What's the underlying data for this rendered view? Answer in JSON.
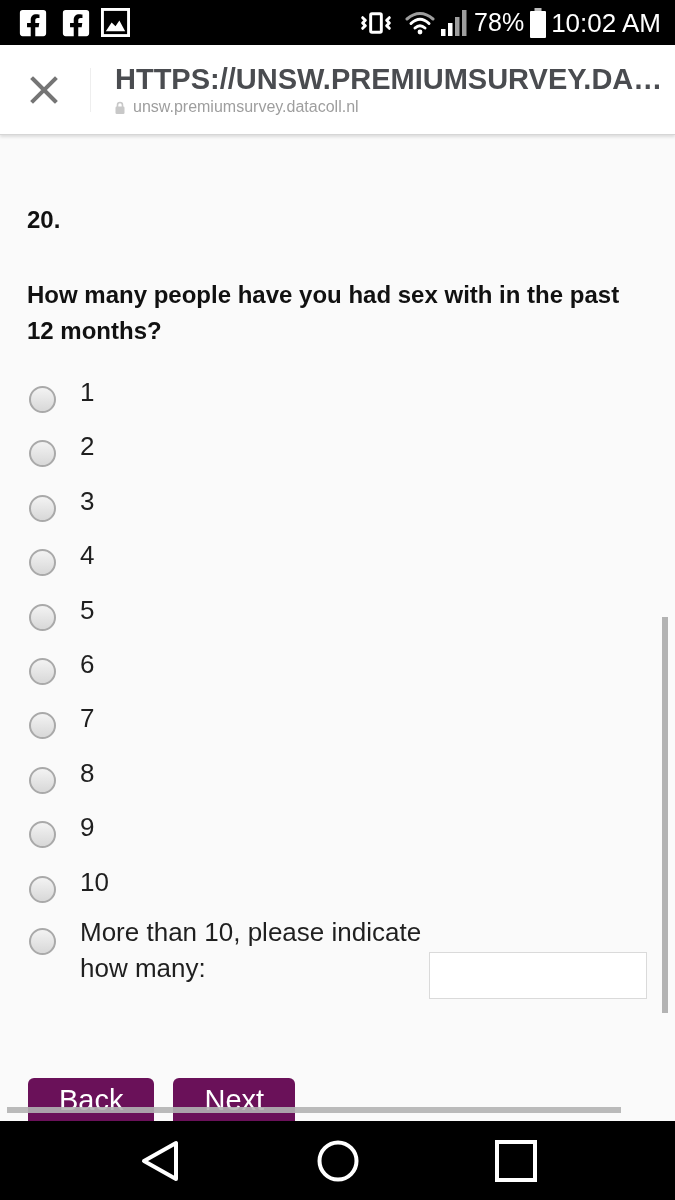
{
  "status_bar": {
    "battery": "78%",
    "time": "10:02 AM"
  },
  "browser_bar": {
    "title": "HTTPS://UNSW.PREMIUMSURVEY.DA…",
    "url": "unsw.premiumsurvey.datacoll.nl"
  },
  "question": {
    "number": "20.",
    "text": "How many people have you had sex with in the past 12 months?",
    "options": [
      {
        "label": "1",
        "kind": "choice",
        "selected": false
      },
      {
        "label": "2",
        "kind": "choice",
        "selected": false
      },
      {
        "label": "3",
        "kind": "choice",
        "selected": false
      },
      {
        "label": "4",
        "kind": "choice",
        "selected": false
      },
      {
        "label": "5",
        "kind": "choice",
        "selected": false
      },
      {
        "label": "6",
        "kind": "choice",
        "selected": false
      },
      {
        "label": "7",
        "kind": "choice",
        "selected": false
      },
      {
        "label": "8",
        "kind": "choice",
        "selected": false
      },
      {
        "label": "9",
        "kind": "choice",
        "selected": false
      },
      {
        "label": "10",
        "kind": "choice",
        "selected": false
      },
      {
        "label": "More than 10, please indicate how many:",
        "kind": "choice_with_input",
        "selected": false
      }
    ]
  },
  "buttons": [
    "Back",
    "Next"
  ]
}
